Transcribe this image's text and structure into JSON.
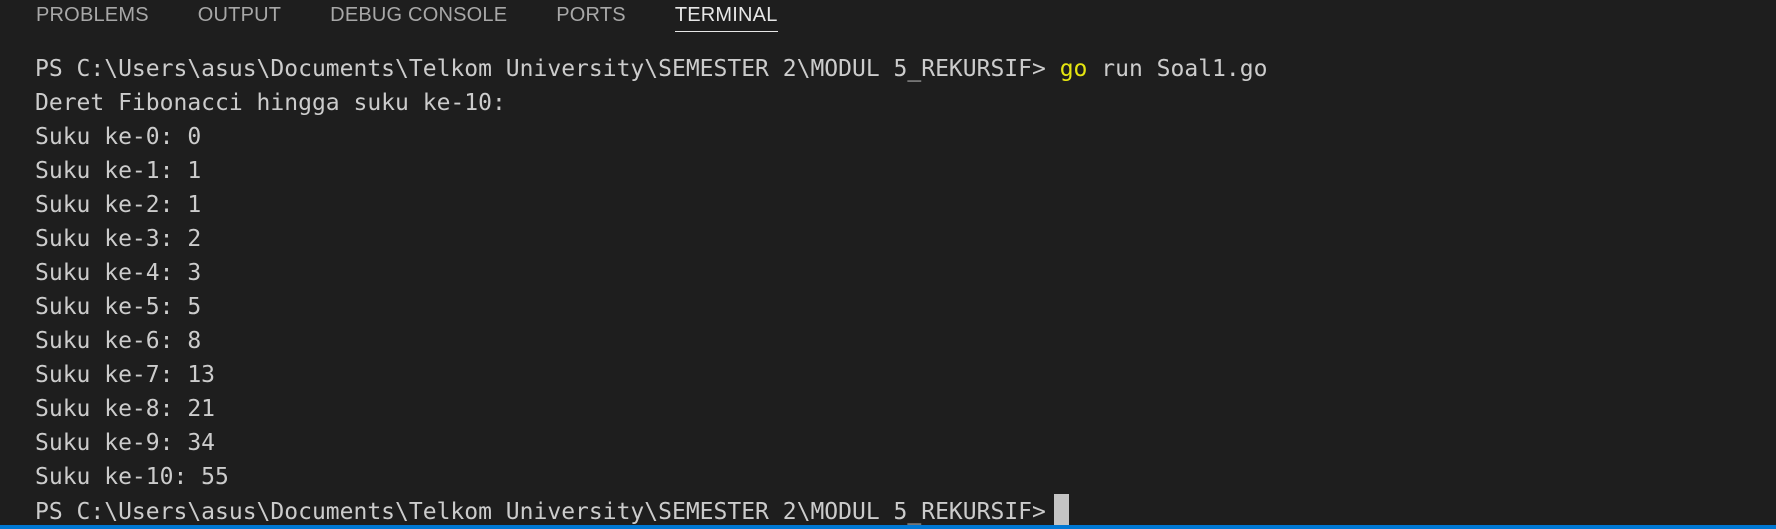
{
  "tabs": [
    {
      "label": "PROBLEMS"
    },
    {
      "label": "OUTPUT"
    },
    {
      "label": "DEBUG CONSOLE"
    },
    {
      "label": "PORTS"
    },
    {
      "label": "TERMINAL",
      "active": true
    }
  ],
  "terminal": {
    "prompt": "PS C:\\Users\\asus\\Documents\\Telkom University\\SEMESTER 2\\MODUL 5_REKURSIF>",
    "command": {
      "keyword": "go",
      "args": "run Soal1.go"
    },
    "output": [
      "Deret Fibonacci hingga suku ke-10:",
      "Suku ke-0: 0",
      "Suku ke-1: 1",
      "Suku ke-2: 1",
      "Suku ke-3: 2",
      "Suku ke-4: 3",
      "Suku ke-5: 5",
      "Suku ke-6: 8",
      "Suku ke-7: 13",
      "Suku ke-8: 21",
      "Suku ke-9: 34",
      "Suku ke-10: 55"
    ],
    "final_prompt": "PS C:\\Users\\asus\\Documents\\Telkom University\\SEMESTER 2\\MODUL 5_REKURSIF>"
  },
  "colors": {
    "background": "#1e1e1e",
    "text": "#cccccc",
    "command_keyword": "#e5e510",
    "active_tab": "#e7e7e7",
    "inactive_tab": "#a8a8a8",
    "cursor": "#c4c4c4",
    "focus_border": "#0078d4"
  }
}
